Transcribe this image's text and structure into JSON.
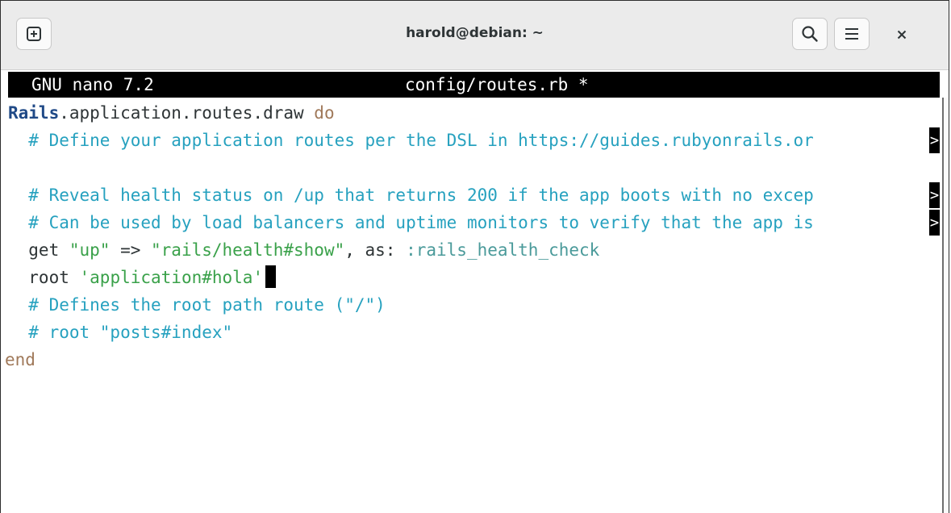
{
  "window": {
    "title": "harold@debian: ~"
  },
  "nano": {
    "version": "GNU nano 7.2",
    "filename": "config/routes.rb *",
    "overflow_glyph": ">"
  },
  "code": {
    "l1_const": "Rails",
    "l1_rest": ".application.routes.draw ",
    "l1_kw": "do",
    "l2": "  # Define your application routes per the DSL in https://guides.rubyonrails.or",
    "l4": "  # Reveal health status on /up that returns 200 if the app boots with no excep",
    "l5": "  # Can be used by load balancers and uptime monitors to verify that the app is",
    "l6_a": "  get ",
    "l6_b": "\"up\"",
    "l6_c": " => ",
    "l6_d": "\"rails/health#show\"",
    "l6_e": ", as: ",
    "l6_f": ":rails_health_check",
    "l7_a": "  root ",
    "l7_b": "'application#hola'",
    "l8": "  # Defines the root path route (\"/\")",
    "l9": "  # root \"posts#index\"",
    "l10": "end"
  },
  "icons": {
    "new_tab": "plus-box-icon",
    "search": "magnifier-icon",
    "menu": "hamburger-icon",
    "close": "close-icon"
  }
}
